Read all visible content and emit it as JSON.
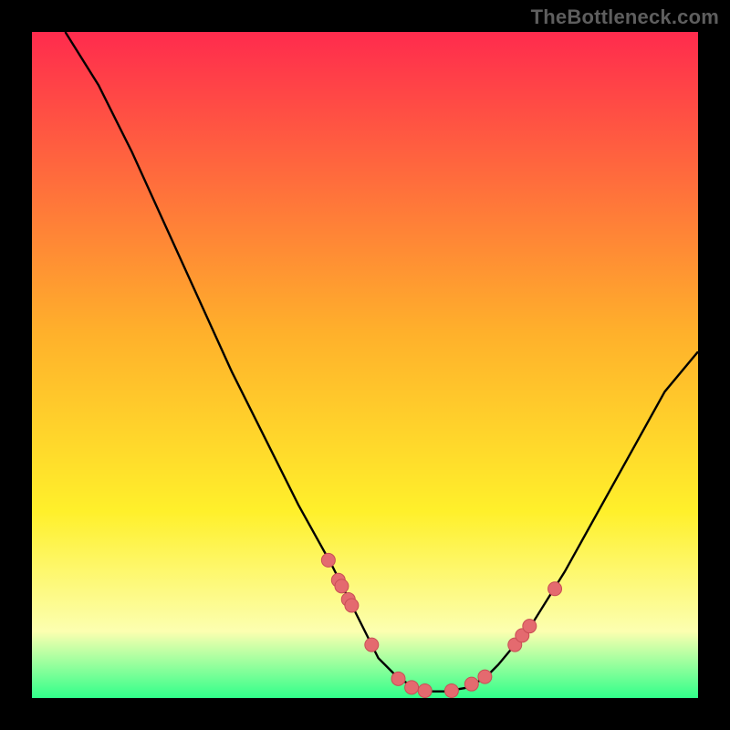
{
  "watermark": "TheBottleneck.com",
  "colors": {
    "gradient_top": "#ff2b4d",
    "gradient_mid1": "#ffb02b",
    "gradient_mid2": "#fff02b",
    "gradient_pale": "#fcffb0",
    "gradient_bottom": "#30ff8a",
    "curve": "#000000",
    "dot_fill": "#e46a6f",
    "dot_stroke": "#c94e55"
  },
  "chart_data": {
    "type": "line",
    "title": "",
    "xlabel": "",
    "ylabel": "",
    "xlim": [
      0,
      100
    ],
    "ylim": [
      0,
      100
    ],
    "curve": {
      "x": [
        5,
        10,
        15,
        20,
        25,
        30,
        35,
        40,
        45,
        50,
        52,
        55,
        58,
        60,
        62,
        65,
        68,
        70,
        75,
        80,
        85,
        90,
        95,
        100
      ],
      "y": [
        100,
        92,
        82,
        71,
        60,
        49,
        39,
        29,
        20,
        10,
        6,
        3,
        1.3,
        1,
        1,
        1.5,
        3,
        5,
        11,
        19,
        28,
        37,
        46,
        52
      ]
    },
    "dots": {
      "x": [
        44.5,
        46.0,
        46.5,
        47.5,
        48.0,
        51.0,
        55.0,
        57.0,
        59.0,
        63.0,
        66.0,
        68.0,
        72.5,
        73.6,
        74.7,
        78.5
      ],
      "y": [
        20.7,
        17.7,
        16.8,
        14.8,
        13.9,
        8.0,
        2.9,
        1.6,
        1.1,
        1.1,
        2.1,
        3.2,
        8.0,
        9.4,
        10.8,
        16.4
      ]
    }
  }
}
